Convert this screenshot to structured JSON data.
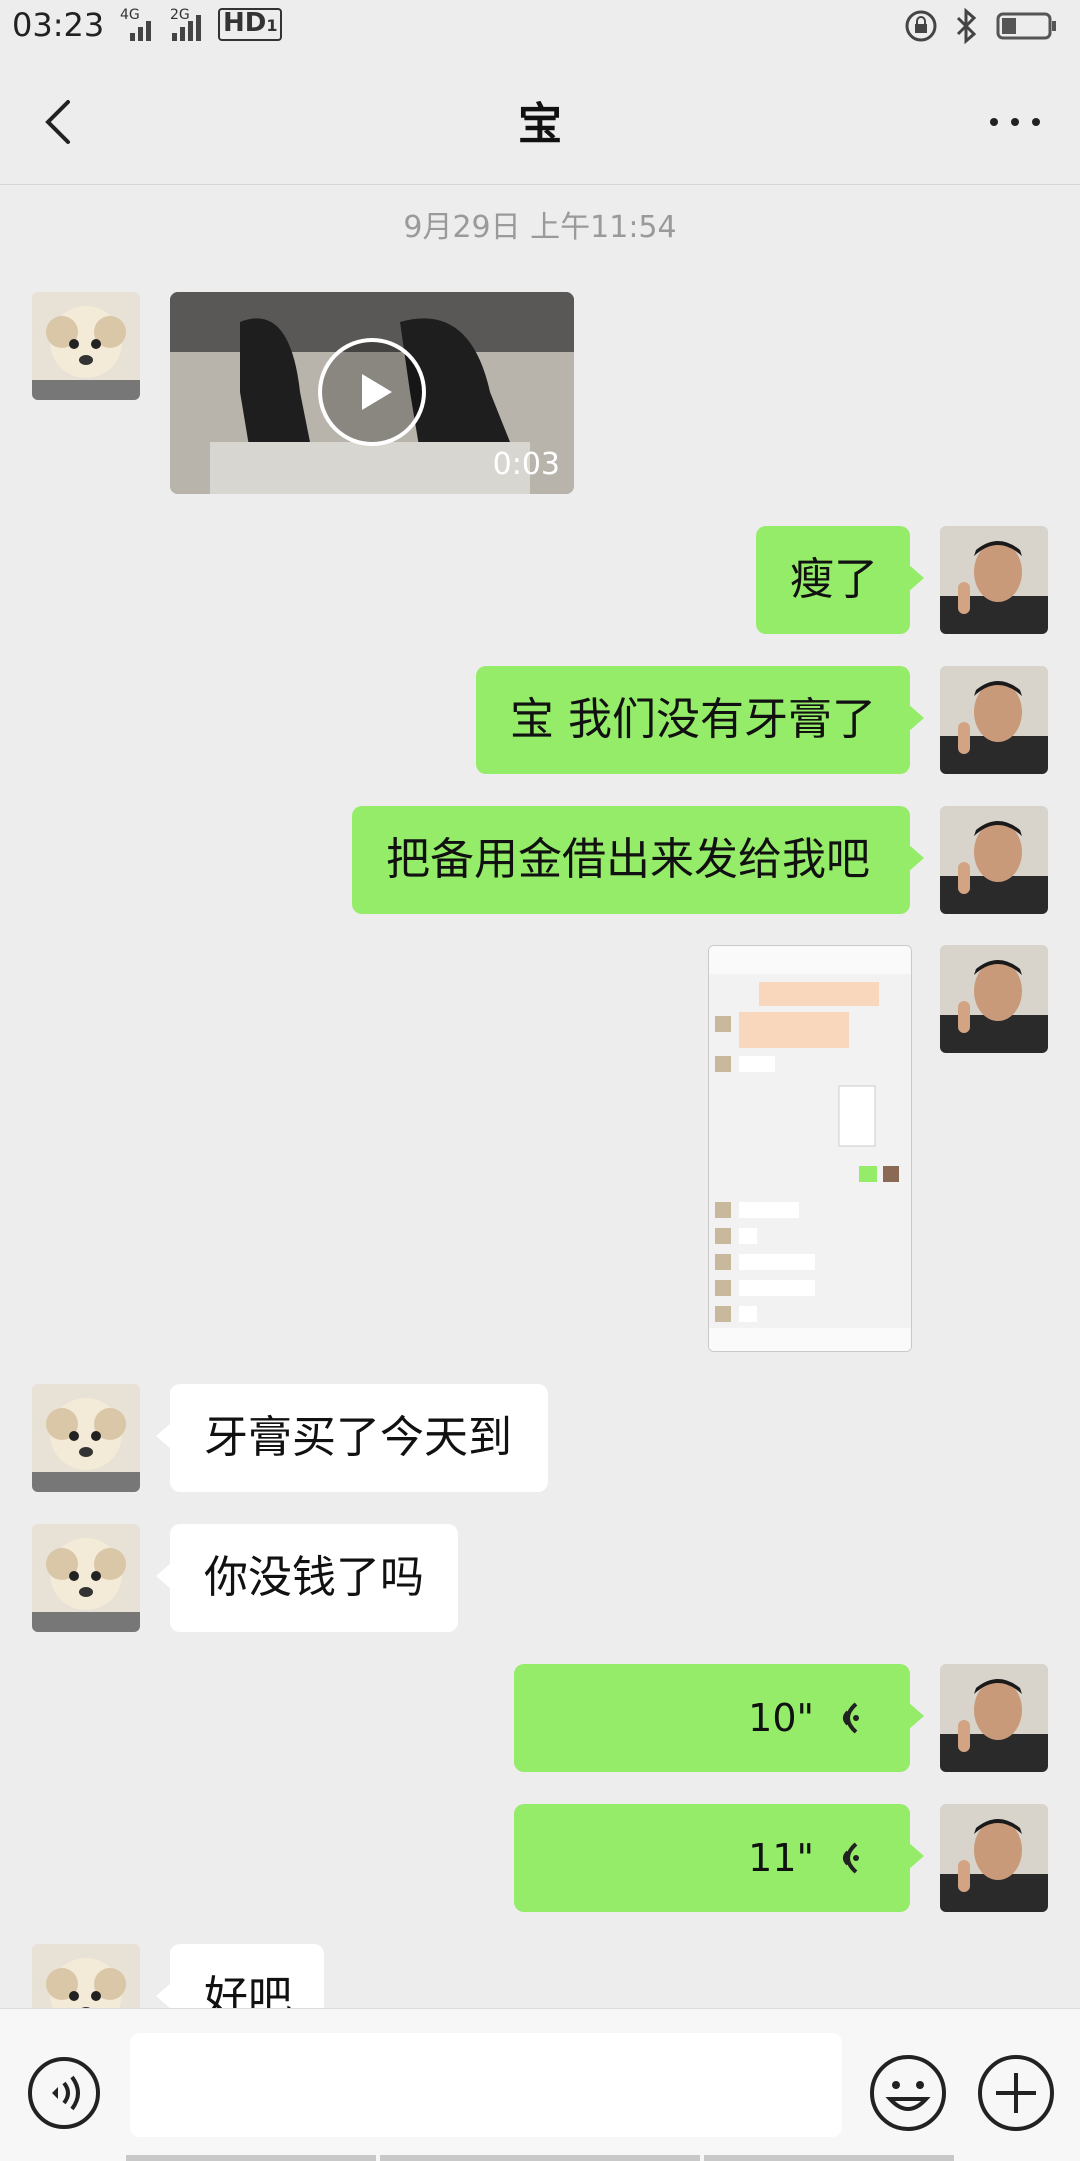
{
  "status_bar": {
    "time": "03:23",
    "network_1": "4G",
    "network_2": "2G",
    "hd_label": "HD",
    "hd_sub": "1"
  },
  "header": {
    "title": "宝"
  },
  "timestamp": "9月29日 上午11:54",
  "messages": [
    {
      "type": "video",
      "side": "left",
      "duration": "0:03"
    },
    {
      "type": "text",
      "side": "right",
      "text": "瘦了"
    },
    {
      "type": "text",
      "side": "right",
      "text": "宝 我们没有牙膏了"
    },
    {
      "type": "text",
      "side": "right",
      "text": "把备用金借出来发给我吧"
    },
    {
      "type": "image",
      "side": "right"
    },
    {
      "type": "text",
      "side": "left",
      "text": "牙膏买了今天到"
    },
    {
      "type": "text",
      "side": "left",
      "text": "你没钱了吗"
    },
    {
      "type": "voice",
      "side": "right",
      "duration": "10\""
    },
    {
      "type": "voice",
      "side": "right",
      "duration": "11\""
    },
    {
      "type": "text",
      "side": "left",
      "text": "好吧"
    }
  ],
  "input_bar": {
    "placeholder": ""
  },
  "colors": {
    "background": "#ededed",
    "sent_bubble": "#95ec69",
    "received_bubble": "#ffffff"
  }
}
